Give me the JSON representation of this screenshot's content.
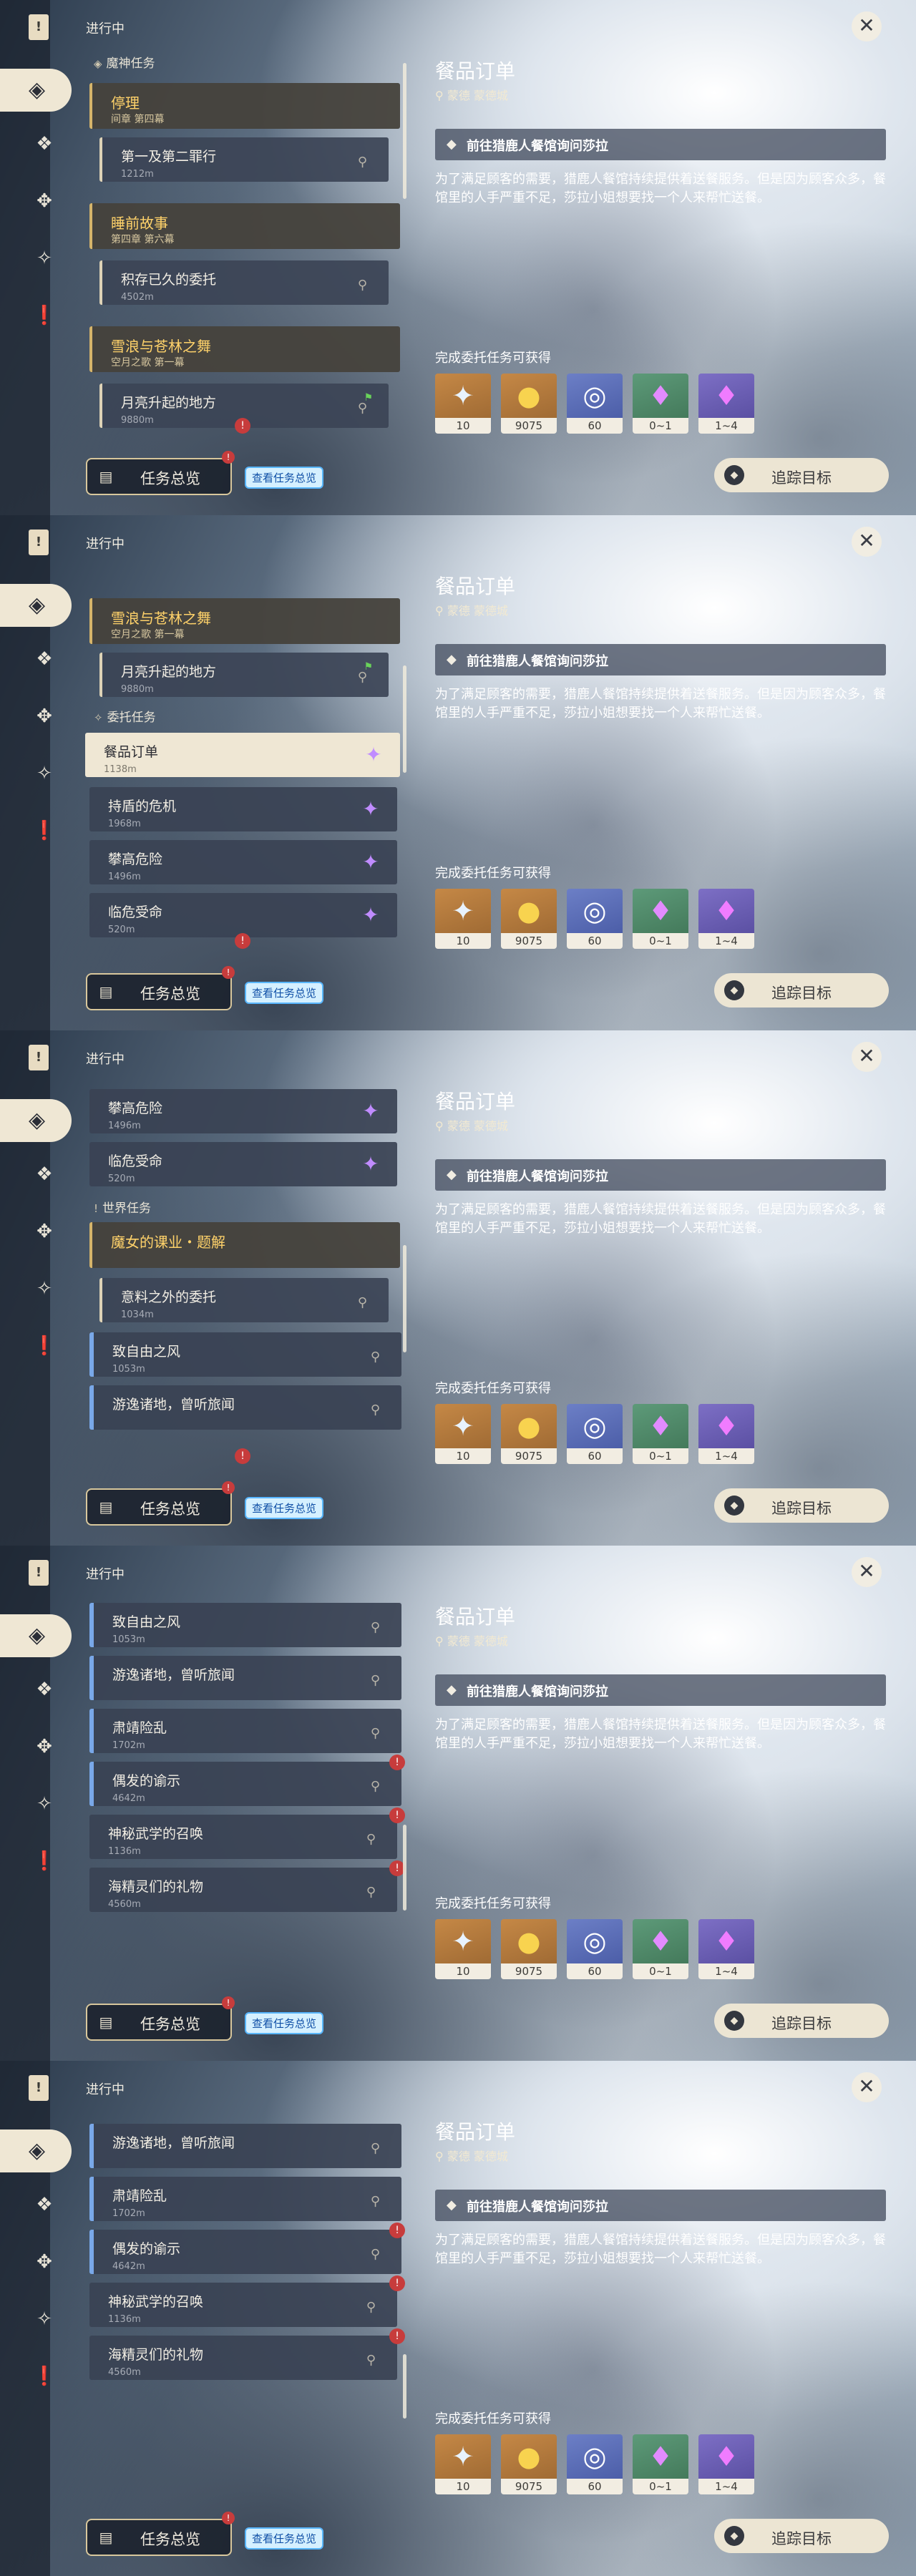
{
  "sidebar": {
    "flag_glyph": "!",
    "icons": [
      "quest-target-icon",
      "archon-quest-icon",
      "story-quest-icon",
      "commission-icon",
      "world-quest-icon"
    ],
    "active_glyph": "◈"
  },
  "header": {
    "section": "进行中",
    "close_glyph": "✕"
  },
  "groups": {
    "archon": "魔神任务",
    "commission": "委托任务",
    "world": "世界任务"
  },
  "quests": {
    "tingli": {
      "title": "停理",
      "sub": "间章 第四幕"
    },
    "first_and_second_sin": {
      "title": "第一及第二罪行",
      "dist": "1212m"
    },
    "bedtime_story": {
      "title": "睡前故事",
      "sub": "第四章 第六幕"
    },
    "old_commission": {
      "title": "积存已久的委托",
      "dist": "4502m"
    },
    "snow_and_pine": {
      "title": "雪浪与苍林之舞",
      "sub": "空月之歌 第一幕"
    },
    "moon_rise": {
      "title": "月亮升起的地方",
      "dist": "9880m"
    },
    "food_order": {
      "title": "餐品订单",
      "dist": "1138m"
    },
    "shield_danger": {
      "title": "持盾的危机",
      "dist": "1968m"
    },
    "climb_danger": {
      "title": "攀高危险",
      "dist": "1496m"
    },
    "order_crisis": {
      "title": "临危受命",
      "dist": "520m"
    },
    "witch_lesson": {
      "title": "魔女的课业・题解",
      "sub": ""
    },
    "unexpected_commission": {
      "title": "意料之外的委托",
      "dist": "1034m"
    },
    "free_wind": {
      "title": "致自由之风",
      "dist": "1053m"
    },
    "wander": {
      "title": "游逸诸地，曾听旅闻",
      "dist": ""
    },
    "sujing": {
      "title": "肃靖险乱",
      "dist": "1702m"
    },
    "oracle": {
      "title": "偶发的谕示",
      "dist": "4642m"
    },
    "martial": {
      "title": "神秘武学的召唤",
      "dist": "1136m"
    },
    "sea_spirit": {
      "title": "海精灵们的礼物",
      "dist": "4560m"
    }
  },
  "bottom": {
    "overview": "任务总览",
    "tooltip": "查看任务总览",
    "badge": "!",
    "track": "追踪目标"
  },
  "detail": {
    "title": "餐品订单",
    "location": "蒙德 蒙德城",
    "step": "前往猎鹿人餐馆询问莎拉",
    "description": "为了满足顾客的需要，猎鹿人餐馆持续提供着送餐服务。但是因为顾客众多，餐馆里的人手严重不足，莎拉小姐想要找一个人来帮忙送餐。",
    "reward_label": "完成委托任务可获得",
    "rewards": [
      {
        "name": "primogem-icon",
        "count": "10"
      },
      {
        "name": "mora-icon",
        "count": "9075"
      },
      {
        "name": "companionship-exp-icon",
        "count": "60"
      },
      {
        "name": "crystal-ore-icon",
        "count": "0~1"
      },
      {
        "name": "ascension-gem-icon",
        "count": "1~4"
      }
    ]
  }
}
